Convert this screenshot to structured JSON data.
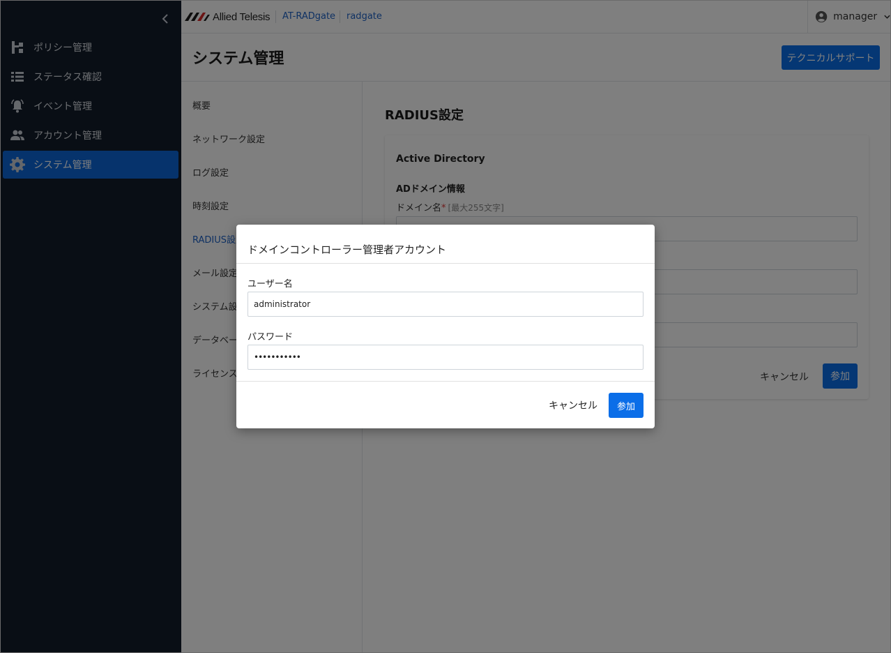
{
  "header": {
    "brand": "Allied Telesis",
    "product": "AT-RADgate",
    "host": "radgate",
    "user": "manager"
  },
  "sidebar": {
    "items": [
      {
        "label": "ポリシー管理",
        "icon": "policy-icon"
      },
      {
        "label": "ステータス確認",
        "icon": "list-icon"
      },
      {
        "label": "イベント管理",
        "icon": "bell-icon"
      },
      {
        "label": "アカウント管理",
        "icon": "people-icon"
      },
      {
        "label": "システム管理",
        "icon": "gear-icon",
        "active": true
      }
    ]
  },
  "page": {
    "title": "システム管理",
    "tech_support": "テクニカルサポート"
  },
  "subnav": {
    "items": [
      "概要",
      "ネットワーク設定",
      "ログ設定",
      "時刻設定",
      "RADIUS設定",
      "メール設定",
      "システム設定",
      "データベース",
      "ライセンス"
    ],
    "active": "RADIUS設定"
  },
  "main": {
    "section_title": "RADIUS設定",
    "card": {
      "heading": "Active Directory",
      "subheading": "ADドメイン情報",
      "domain_label": "ドメイン名",
      "required_mark": "*",
      "domain_hint": "[最大255文字]",
      "cancel": "キャンセル",
      "join": "参加"
    }
  },
  "modal": {
    "title": "ドメインコントローラー管理者アカウント",
    "username_label": "ユーザー名",
    "username_value": "administrator",
    "password_label": "パスワード",
    "password_value": "•••••••••••",
    "cancel": "キャンセル",
    "join": "参加"
  },
  "colors": {
    "sidebar_bg": "#131c2b",
    "accent": "#0b6ee8",
    "link": "#1e63c7"
  }
}
